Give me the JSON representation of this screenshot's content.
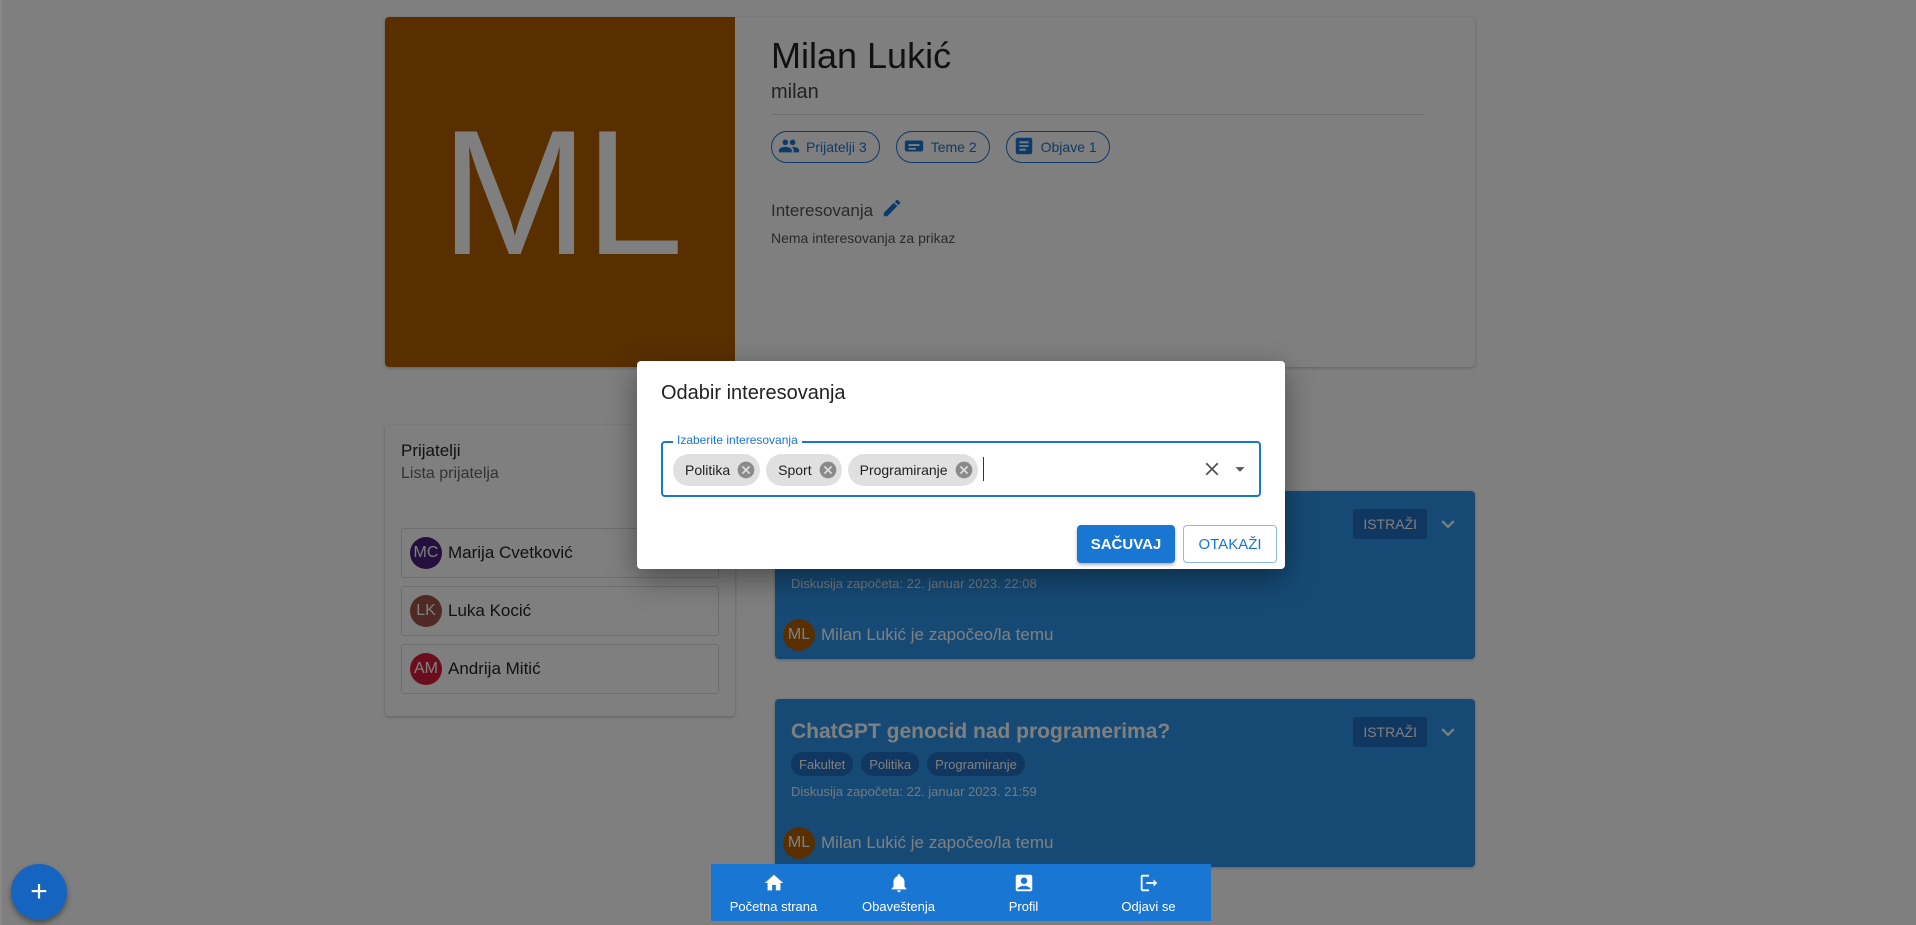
{
  "profile": {
    "avatar_initials": "ML",
    "name": "Milan Lukić",
    "username": "milan",
    "stats": [
      {
        "label": "Prijatelji 3",
        "icon": "people-icon"
      },
      {
        "label": "Teme 2",
        "icon": "topic-icon"
      },
      {
        "label": "Objave 1",
        "icon": "article-icon"
      }
    ],
    "interests_title": "Interesovanja",
    "interests_empty": "Nema interesovanja za prikaz"
  },
  "friends": {
    "title": "Prijatelji",
    "subtitle": "Lista prijatelja",
    "items": [
      {
        "initials": "MC",
        "name": "Marija Cvetković",
        "color": "#4a1f7a"
      },
      {
        "initials": "LK",
        "name": "Luka Kocić",
        "color": "#a0524a"
      },
      {
        "initials": "AM",
        "name": "Andrija Mitić",
        "color": "#d81b3c"
      }
    ]
  },
  "topics": [
    {
      "title": "",
      "tags": [],
      "date": "Diskusija započeta: 22. januar 2023. 22:08",
      "author_initials": "ML",
      "author_text": "Milan Lukić je započeo/la temu",
      "explore_label": "ISTRAŽI"
    },
    {
      "title": "ChatGPT genocid nad programerima?",
      "tags": [
        "Fakultet",
        "Politika",
        "Programiranje"
      ],
      "date": "Diskusija započeta: 22. januar 2023. 21:59",
      "author_initials": "ML",
      "author_text": "Milan Lukić je započeo/la temu",
      "explore_label": "ISTRAŽI"
    }
  ],
  "fab": {
    "label": "+"
  },
  "bottom_nav": [
    {
      "label": "Početna strana",
      "icon": "home-icon"
    },
    {
      "label": "Obaveštenja",
      "icon": "bell-icon"
    },
    {
      "label": "Profil",
      "icon": "profile-icon"
    },
    {
      "label": "Odjavi se",
      "icon": "logout-icon"
    }
  ],
  "dialog": {
    "title": "Odabir interesovanja",
    "field_label": "Izaberite interesovanja",
    "selected": [
      "Politika",
      "Sport",
      "Programiranje"
    ],
    "input_value": "",
    "save_label": "SAČUVAJ",
    "cancel_label": "OTAKAŽI"
  },
  "colors": {
    "primary": "#1976d2",
    "avatar_bg": "#b35f00",
    "topic_card_bg": "#2d95ea"
  }
}
